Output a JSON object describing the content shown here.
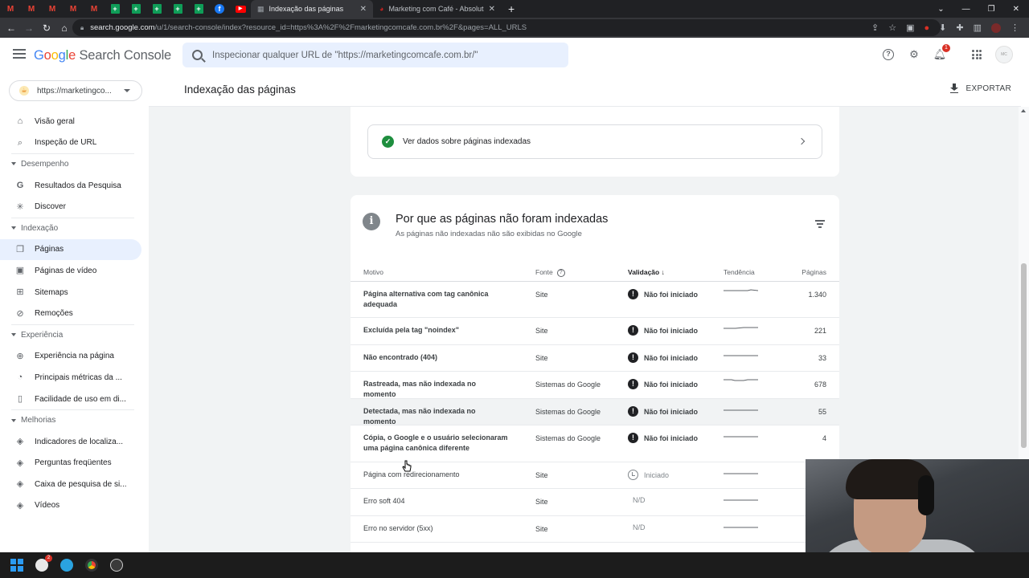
{
  "browser": {
    "tabs": [
      {
        "title": "Indexação das páginas",
        "active": true
      },
      {
        "title": "Marketing com Café - Absolutam",
        "active": false
      }
    ],
    "url_host": "search.google.com",
    "url_path": "/u/1/search-console/index?resource_id=https%3A%2F%2Fmarketingcomcafe.com.br%2F&pages=ALL_URLS",
    "extension_badge": "1"
  },
  "app": {
    "logo_google": "Google",
    "logo_product": "Search Console",
    "search_placeholder": "Inspecionar qualquer URL de \"https://marketingcomcafe.com.br/\"",
    "notification_count": "1",
    "property": "https://marketingco..."
  },
  "sidebar": {
    "top_items": [
      {
        "label": "Visão geral",
        "icon": "home-icon"
      },
      {
        "label": "Inspeção de URL",
        "icon": "search-icon"
      }
    ],
    "sections": [
      {
        "title": "Desempenho",
        "items": [
          {
            "label": "Resultados da Pesquisa",
            "icon": "google-g-icon"
          },
          {
            "label": "Discover",
            "icon": "asterisk-icon"
          }
        ]
      },
      {
        "title": "Indexação",
        "items": [
          {
            "label": "Páginas",
            "icon": "pages-icon",
            "active": true
          },
          {
            "label": "Páginas de vídeo",
            "icon": "video-pages-icon"
          },
          {
            "label": "Sitemaps",
            "icon": "sitemap-icon"
          },
          {
            "label": "Remoções",
            "icon": "removals-icon"
          }
        ]
      },
      {
        "title": "Experiência",
        "items": [
          {
            "label": "Experiência na página",
            "icon": "plus-circle-icon"
          },
          {
            "label": "Principais métricas da ...",
            "icon": "gauge-icon"
          },
          {
            "label": "Facilidade de uso em di...",
            "icon": "phone-icon"
          }
        ]
      },
      {
        "title": "Melhorias",
        "items": [
          {
            "label": "Indicadores de localiza...",
            "icon": "layers-icon"
          },
          {
            "label": "Perguntas freqüentes",
            "icon": "layers-icon"
          },
          {
            "label": "Caixa de pesquisa de si...",
            "icon": "layers-icon"
          },
          {
            "label": "Vídeos",
            "icon": "layers-icon"
          }
        ]
      }
    ]
  },
  "header": {
    "title": "Indexação das páginas",
    "export_label": "EXPORTAR"
  },
  "indexed_card": {
    "label": "Ver dados sobre páginas indexadas"
  },
  "not_indexed": {
    "title": "Por que as páginas não foram indexadas",
    "subtitle": "As páginas não indexadas não são exibidas no Google",
    "columns": {
      "motivo": "Motivo",
      "fonte": "Fonte",
      "validacao": "Validação",
      "tendencia": "Tendência",
      "paginas": "Páginas"
    },
    "rows": [
      {
        "motivo": "Página alternativa com tag canônica adequada",
        "fonte": "Site",
        "validacao": "Não foi iniciado",
        "status": "warn",
        "paginas": "1.340"
      },
      {
        "motivo": "Excluída pela tag \"noindex\"",
        "fonte": "Site",
        "validacao": "Não foi iniciado",
        "status": "warn",
        "paginas": "221"
      },
      {
        "motivo": "Não encontrado (404)",
        "fonte": "Site",
        "validacao": "Não foi iniciado",
        "status": "warn",
        "paginas": "33"
      },
      {
        "motivo": "Rastreada, mas não indexada no momento",
        "fonte": "Sistemas do Google",
        "validacao": "Não foi iniciado",
        "status": "warn",
        "paginas": "678"
      },
      {
        "motivo": "Detectada, mas não indexada no momento",
        "fonte": "Sistemas do Google",
        "validacao": "Não foi iniciado",
        "status": "warn",
        "paginas": "55"
      },
      {
        "motivo": "Cópia, o Google e o usuário selecionaram uma página canônica diferente",
        "fonte": "Sistemas do Google",
        "validacao": "Não foi iniciado",
        "status": "warn",
        "paginas": "4"
      },
      {
        "motivo": "Página com redirecionamento",
        "fonte": "Site",
        "validacao": "Iniciado",
        "status": "clock",
        "paginas": ""
      },
      {
        "motivo": "Erro soft 404",
        "fonte": "Site",
        "validacao": "N/D",
        "status": "na",
        "paginas": ""
      },
      {
        "motivo": "Erro no servidor (5xx)",
        "fonte": "Site",
        "validacao": "N/D",
        "status": "na",
        "paginas": ""
      }
    ]
  },
  "taskbar": {
    "badge_count": "2"
  }
}
